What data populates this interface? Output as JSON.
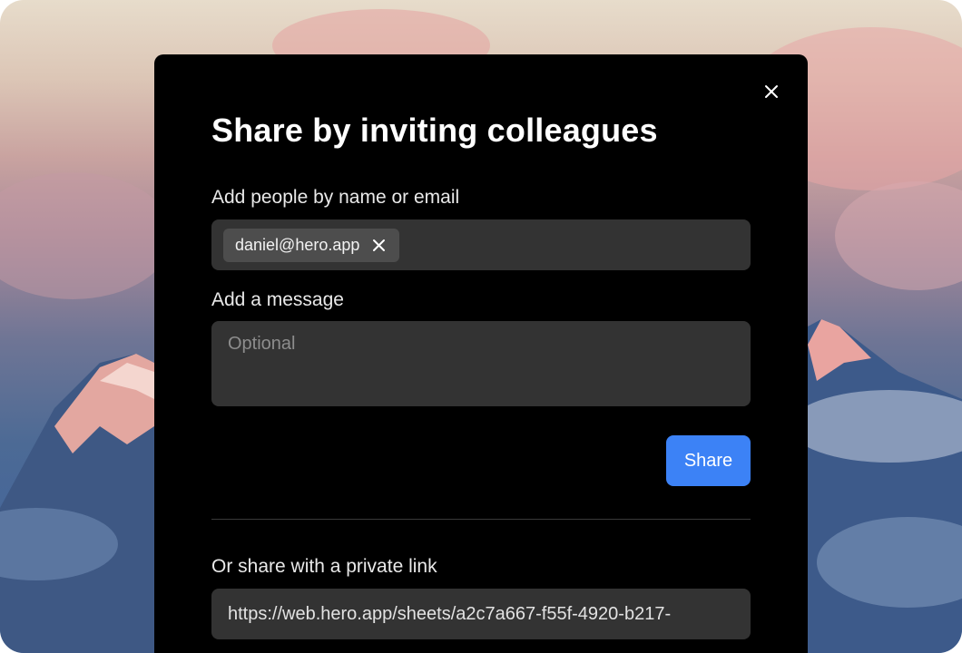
{
  "dialog": {
    "title": "Share by inviting colleagues",
    "close_icon": "close-icon",
    "people": {
      "label": "Add people by name or email",
      "chips": [
        {
          "label": "daniel@hero.app",
          "remove_icon": "close-icon"
        }
      ]
    },
    "message": {
      "label": "Add a message",
      "placeholder": "Optional",
      "value": ""
    },
    "share_button": "Share",
    "link": {
      "label": "Or share with a private link",
      "value": "https://web.hero.app/sheets/a2c7a667-f55f-4920-b217-"
    }
  },
  "colors": {
    "dialog_background": "#000000",
    "field_background": "#333333",
    "chip_background": "#4d4d4d",
    "accent": "#3c82f6"
  }
}
